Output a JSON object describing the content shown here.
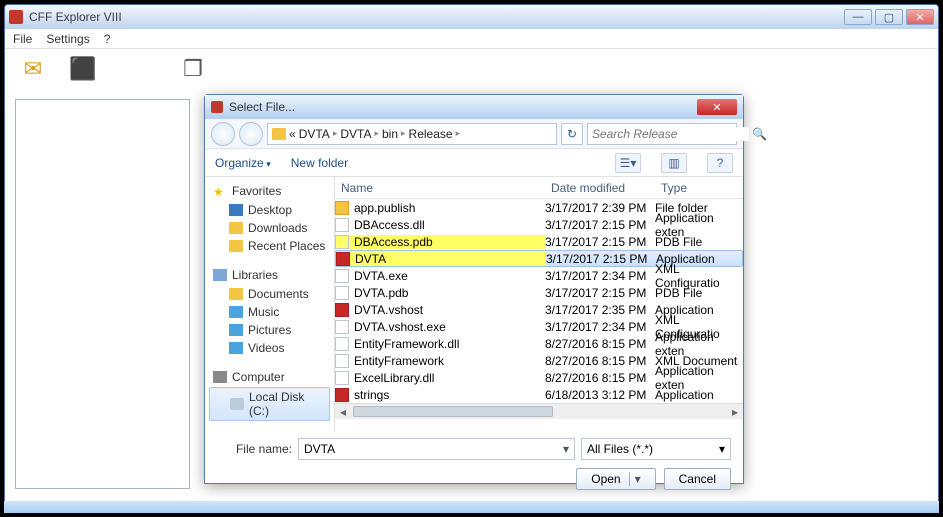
{
  "window": {
    "title": "CFF Explorer VIII",
    "menu": {
      "file": "File",
      "settings": "Settings",
      "help": "?"
    }
  },
  "dialog": {
    "title": "Select File...",
    "breadcrumb": {
      "root": "«",
      "p1": "DVTA",
      "p2": "DVTA",
      "p3": "bin",
      "p4": "Release"
    },
    "search_placeholder": "Search Release",
    "toolbar": {
      "organize": "Organize",
      "newfolder": "New folder"
    },
    "tree": {
      "favorites": "Favorites",
      "desktop": "Desktop",
      "downloads": "Downloads",
      "recent": "Recent Places",
      "libraries": "Libraries",
      "documents": "Documents",
      "music": "Music",
      "pictures": "Pictures",
      "videos": "Videos",
      "computer": "Computer",
      "localdisk": "Local Disk (C:)"
    },
    "columns": {
      "name": "Name",
      "date": "Date modified",
      "type": "Type"
    },
    "files": [
      {
        "name": "app.publish",
        "date": "3/17/2017 2:39 PM",
        "type": "File folder",
        "icon": "folder"
      },
      {
        "name": "DBAccess.dll",
        "date": "3/17/2017 2:15 PM",
        "type": "Application exten",
        "icon": "file"
      },
      {
        "name": "DBAccess.pdb",
        "date": "3/17/2017 2:15 PM",
        "type": "PDB File",
        "icon": "file",
        "hl": true
      },
      {
        "name": "DVTA",
        "date": "3/17/2017 2:15 PM",
        "type": "Application",
        "icon": "exe",
        "hl": true,
        "sel": true
      },
      {
        "name": "DVTA.exe",
        "date": "3/17/2017 2:34 PM",
        "type": "XML Configuratio",
        "icon": "file"
      },
      {
        "name": "DVTA.pdb",
        "date": "3/17/2017 2:15 PM",
        "type": "PDB File",
        "icon": "file"
      },
      {
        "name": "DVTA.vshost",
        "date": "3/17/2017 2:35 PM",
        "type": "Application",
        "icon": "exe"
      },
      {
        "name": "DVTA.vshost.exe",
        "date": "3/17/2017 2:34 PM",
        "type": "XML Configuratio",
        "icon": "file"
      },
      {
        "name": "EntityFramework.dll",
        "date": "8/27/2016 8:15 PM",
        "type": "Application exten",
        "icon": "file"
      },
      {
        "name": "EntityFramework",
        "date": "8/27/2016 8:15 PM",
        "type": "XML Document",
        "icon": "file"
      },
      {
        "name": "ExcelLibrary.dll",
        "date": "8/27/2016 8:15 PM",
        "type": "Application exten",
        "icon": "file"
      },
      {
        "name": "strings",
        "date": "6/18/2013 3:12 PM",
        "type": "Application",
        "icon": "exe"
      }
    ],
    "filename_label": "File name:",
    "filename_value": "DVTA",
    "filter": "All Files (*.*)",
    "open": "Open",
    "cancel": "Cancel"
  }
}
